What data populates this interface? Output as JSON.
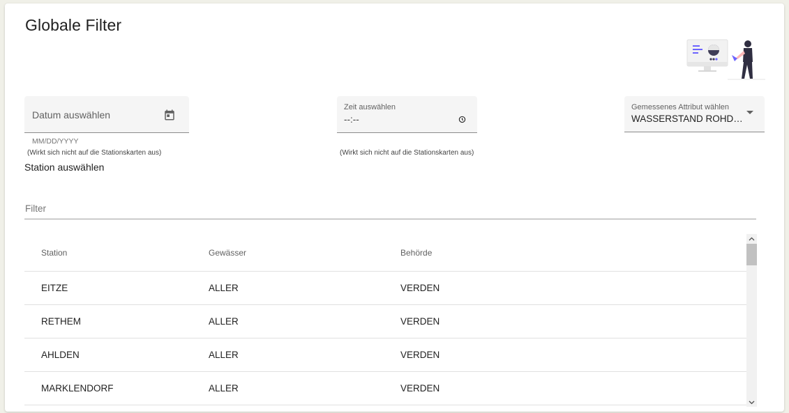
{
  "page": {
    "title": "Globale Filter"
  },
  "date_field": {
    "placeholder": "Datum auswählen",
    "format_hint": "MM/DD/YYYY",
    "hint": "(Wirkt sich nicht auf die Stationskarten aus)",
    "icon": "calendar-icon"
  },
  "time_field": {
    "label": "Zeit auswählen",
    "value": "--:--",
    "hint": "(Wirkt sich nicht auf die Stationskarten aus)",
    "icon": "clock-icon"
  },
  "attribute_field": {
    "label": "Gemessenes Attribut wählen",
    "value": "WASSERSTAND ROHDATEN",
    "icon": "dropdown-arrow-icon"
  },
  "station": {
    "label": "Station auswählen",
    "filter_placeholder": "Filter"
  },
  "table": {
    "headers": [
      "Station",
      "Gewässer",
      "Behörde"
    ],
    "rows": [
      [
        "EITZE",
        "ALLER",
        "VERDEN"
      ],
      [
        "RETHEM",
        "ALLER",
        "VERDEN"
      ],
      [
        "AHLDEN",
        "ALLER",
        "VERDEN"
      ],
      [
        "MARKLENDORF",
        "ALLER",
        "VERDEN"
      ]
    ]
  },
  "colors": {
    "accent": "#6c63ff",
    "field_background": "#f5f5f5",
    "page_background": "#f0f0e8"
  }
}
